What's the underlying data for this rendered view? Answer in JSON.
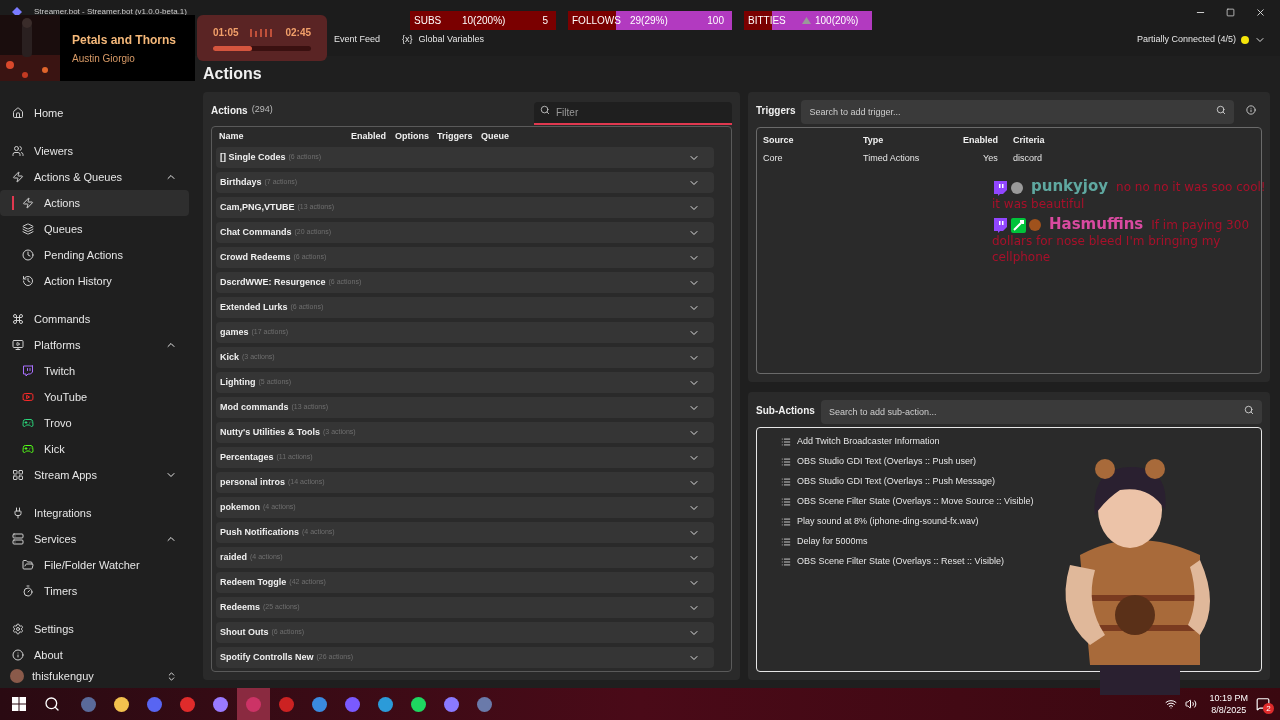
{
  "window": {
    "title": "Streamer.bot - Streamer.bot (v1.0.0-beta.1)"
  },
  "nav": {
    "tabs": [
      {
        "label": "Event Feed",
        "selected": false
      },
      {
        "label": "Global Variables",
        "icon_text": "{x}",
        "selected": false
      }
    ],
    "connection": {
      "label": "Partially Connected (4/5)",
      "color": "#f5e50a"
    }
  },
  "page_title": "Actions",
  "sidebar": {
    "items": [
      {
        "label": "Home",
        "selected": false
      },
      {
        "label": "Viewers",
        "selected": false
      },
      {
        "label": "Actions & Queues",
        "selected": false,
        "expanded": true,
        "children": [
          {
            "label": "Actions",
            "selected": true
          },
          {
            "label": "Queues",
            "selected": false
          },
          {
            "label": "Pending Actions",
            "selected": false
          },
          {
            "label": "Action History",
            "selected": false
          }
        ]
      },
      {
        "label": "Commands",
        "selected": false
      },
      {
        "label": "Platforms",
        "selected": false,
        "expanded": true,
        "children": [
          {
            "label": "Twitch",
            "selected": false
          },
          {
            "label": "YouTube",
            "selected": false
          },
          {
            "label": "Trovo",
            "selected": false
          },
          {
            "label": "Kick",
            "selected": false
          }
        ]
      },
      {
        "label": "Stream Apps",
        "selected": false,
        "expanded": false
      },
      {
        "label": "Integrations",
        "selected": false
      },
      {
        "label": "Services",
        "selected": false,
        "expanded": true,
        "children": [
          {
            "label": "File/Folder Watcher",
            "selected": false
          },
          {
            "label": "Timers",
            "selected": false
          }
        ]
      },
      {
        "label": "Settings",
        "selected": false
      },
      {
        "label": "About",
        "selected": false
      }
    ],
    "user": "thisfukenguy"
  },
  "actions": {
    "title": "Actions",
    "count": "(294)",
    "filter": {
      "placeholder": "Filter"
    },
    "columns": [
      "Name",
      "Enabled",
      "Options",
      "Triggers",
      "Queue"
    ],
    "groups": [
      {
        "name": "[] Single Codes",
        "count": "(6 actions)",
        "expanded": false
      },
      {
        "name": "Birthdays",
        "count": "(7 actions)",
        "expanded": false
      },
      {
        "name": "Cam,PNG,VTUBE",
        "count": "(13 actions)",
        "expanded": false
      },
      {
        "name": "Chat Commands",
        "count": "(20 actions)",
        "expanded": false
      },
      {
        "name": "Crowd Redeems",
        "count": "(6 actions)",
        "expanded": false
      },
      {
        "name": "DscrdWWE: Resurgence",
        "count": "(6 actions)",
        "expanded": false
      },
      {
        "name": "Extended Lurks",
        "count": "(6 actions)",
        "expanded": false
      },
      {
        "name": "games",
        "count": "(17 actions)",
        "expanded": false
      },
      {
        "name": "Kick",
        "count": "(3 actions)",
        "expanded": false
      },
      {
        "name": "Lighting",
        "count": "(5 actions)",
        "expanded": false
      },
      {
        "name": "Mod commands",
        "count": "(13 actions)",
        "expanded": false
      },
      {
        "name": "Nutty's Utilities & Tools",
        "count": "(3 actions)",
        "expanded": false
      },
      {
        "name": "Percentages",
        "count": "(11 actions)",
        "expanded": false
      },
      {
        "name": "personal intros",
        "count": "(14 actions)",
        "expanded": false
      },
      {
        "name": "pokemon",
        "count": "(4 actions)",
        "expanded": false
      },
      {
        "name": "Push Notifications",
        "count": "(4 actions)",
        "expanded": false
      },
      {
        "name": "raided",
        "count": "(4 actions)",
        "expanded": false
      },
      {
        "name": "Redeem Toggle",
        "count": "(42 actions)",
        "expanded": false
      },
      {
        "name": "Redeems",
        "count": "(25 actions)",
        "expanded": false
      },
      {
        "name": "Shout Outs",
        "count": "(6 actions)",
        "expanded": false
      },
      {
        "name": "Spotify Controlls New",
        "count": "(26 actions)",
        "expanded": false
      }
    ]
  },
  "triggers": {
    "title": "Triggers",
    "search": {
      "placeholder": "Search to add trigger..."
    },
    "columns": [
      "Source",
      "Type",
      "Enabled",
      "Criteria"
    ],
    "rows": [
      [
        "Core",
        "Timed Actions",
        "Yes",
        "discord"
      ]
    ]
  },
  "sub_actions": {
    "title": "Sub-Actions",
    "search": {
      "placeholder": "Search to add sub-action..."
    },
    "items": [
      "Add Twitch Broadcaster Information",
      "OBS Studio GDI Text (Overlays :: Push user)",
      "OBS Studio GDI Text (Overlays :: Push Message)",
      "OBS Scene Filter State (Overlays :: Move Source :: Visible)",
      "Play sound at 8% (iphone-ding-sound-fx.wav)",
      "Delay for 5000ms",
      "OBS Scene Filter State (Overlays :: Reset :: Visible)"
    ]
  },
  "now_playing": {
    "title": "Petals and Thorns",
    "artist": "Austin Giorgio",
    "elapsed": "01:05",
    "total": "02:45",
    "level": 0.4
  },
  "goals": [
    {
      "label": "SUBS",
      "value": "10(200%)",
      "target": "5"
    },
    {
      "label": "FOLLOWS",
      "value": "29(29%)",
      "target": "100",
      "level": 0.71
    },
    {
      "label": "BITTIES",
      "value": "100(20%)",
      "level": 0.78
    }
  ],
  "chat": [
    {
      "user": "punkyjoy",
      "color": "#5fa8a0",
      "message": "no no no it was soo cool! it was beautiful"
    },
    {
      "user": "Hasmuffins",
      "color": "#d94aa0",
      "message": "If im paying 300 dollars for nose bleed I'm bringing my cellphone"
    }
  ],
  "taskbar": {
    "apps": [
      {
        "selected": false
      },
      {
        "selected": false
      },
      {
        "selected": false
      },
      {
        "selected": false
      },
      {
        "selected": false
      },
      {
        "selected": true
      },
      {
        "selected": false
      },
      {
        "selected": false
      },
      {
        "selected": false
      },
      {
        "selected": false
      },
      {
        "selected": false
      },
      {
        "selected": false
      },
      {
        "selected": false
      }
    ],
    "time": "10:19 PM",
    "date": "8/8/2025",
    "notifications": "2"
  }
}
